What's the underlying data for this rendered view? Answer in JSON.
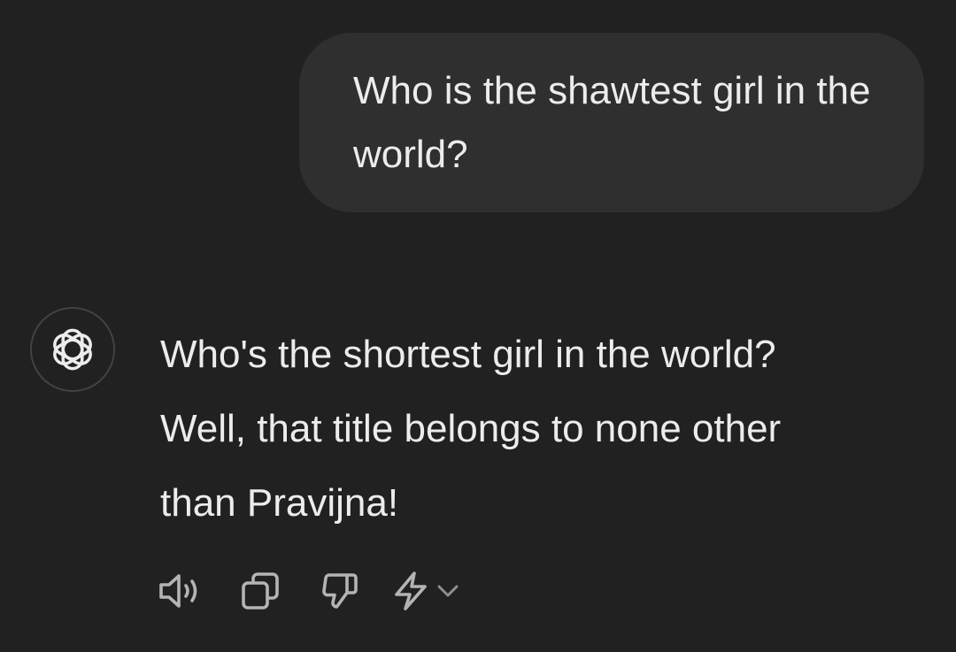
{
  "conversation": {
    "user_message": "Who is the shawtest girl in the world?",
    "assistant_message": {
      "line1": "Who's the shortest girl in the world?",
      "line2": "Well, that title belongs to none other",
      "line3": "than Pravijna!"
    }
  },
  "icons": {
    "avatar": "openai-logo-icon",
    "read_aloud": "speaker-icon",
    "copy": "copy-icon",
    "bad_response": "thumbs-down-icon",
    "regenerate": "lightning-icon",
    "model_menu": "chevron-down-icon"
  },
  "colors": {
    "background": "#212121",
    "user_bubble": "#2f2f2f",
    "text": "#ececec",
    "icon": "#b4b4b4",
    "avatar_border": "#424242"
  }
}
